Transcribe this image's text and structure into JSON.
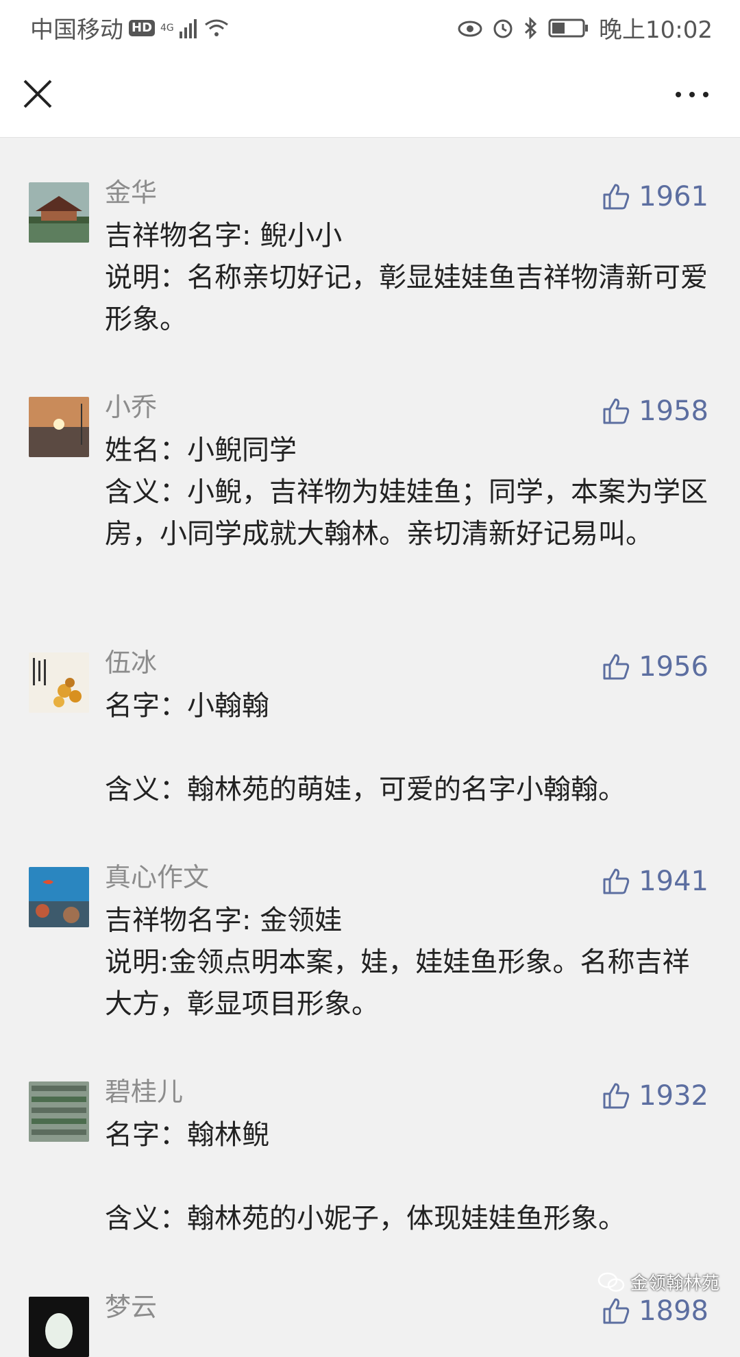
{
  "status_bar": {
    "carrier": "中国移动",
    "hd": "HD",
    "network": "4G",
    "time": "晚上10:02"
  },
  "header": {
    "close_icon": "close-icon",
    "more_icon": "more-icon"
  },
  "comments": [
    {
      "nickname": "金华",
      "likes": "1961",
      "content": "吉祥物名字: 鲵小小\n说明：名称亲切好记，彰显娃娃鱼吉祥物清新可爱形象。"
    },
    {
      "nickname": "小乔",
      "likes": "1958",
      "content": "姓名：小鲵同学\n含义：小鲵，吉祥物为娃娃鱼；同学，本案为学区房，小同学成就大翰林。亲切清新好记易叫。"
    },
    {
      "nickname": "伍冰",
      "likes": "1956",
      "content": "名字：小翰翰\n\n含义：翰林苑的萌娃，可爱的名字小翰翰。"
    },
    {
      "nickname": "真心作文",
      "likes": "1941",
      "content": "吉祥物名字: 金领娃\n说明:金领点明本案，娃，娃娃鱼形象。名称吉祥大方，彰显项目形象。"
    },
    {
      "nickname": "碧桂儿",
      "likes": "1932",
      "content": "名字：翰林鲵\n\n含义：翰林苑的小妮子，体现娃娃鱼形象。"
    },
    {
      "nickname": "梦云",
      "likes": "1898",
      "content": ""
    }
  ],
  "watermark": "金领翰林苑",
  "colors": {
    "like": "#5c6ea0",
    "nickname": "#8c8c8c",
    "background": "#f1f1f1"
  }
}
